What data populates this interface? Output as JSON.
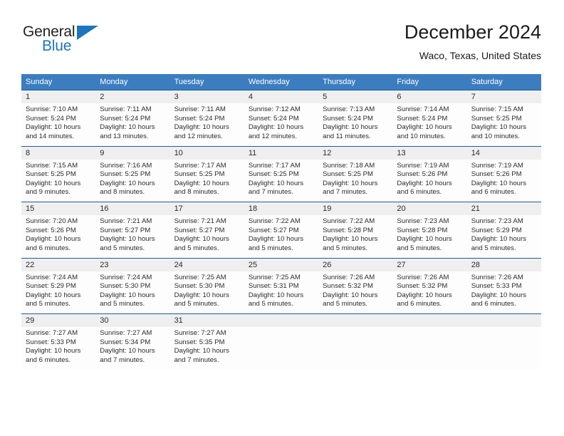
{
  "logo": {
    "word_dark": "General",
    "word_blue": "Blue",
    "triangle_color": "#1b76bc",
    "dark_color": "#231f20"
  },
  "header": {
    "title": "December 2024",
    "subtitle": "Waco, Texas, United States"
  },
  "colors": {
    "header_bg": "#3b7dbf",
    "week_separator": "#1f5c9e",
    "daynum_bg": "#efefef",
    "cell_bg": "#fdfdfd",
    "text": "#2b2b2b"
  },
  "weekday_headers": [
    "Sunday",
    "Monday",
    "Tuesday",
    "Wednesday",
    "Thursday",
    "Friday",
    "Saturday"
  ],
  "weeks": [
    {
      "days": [
        {
          "date": "1",
          "sunrise": "Sunrise: 7:10 AM",
          "sunset": "Sunset: 5:24 PM",
          "daylight1": "Daylight: 10 hours",
          "daylight2": "and 14 minutes."
        },
        {
          "date": "2",
          "sunrise": "Sunrise: 7:11 AM",
          "sunset": "Sunset: 5:24 PM",
          "daylight1": "Daylight: 10 hours",
          "daylight2": "and 13 minutes."
        },
        {
          "date": "3",
          "sunrise": "Sunrise: 7:11 AM",
          "sunset": "Sunset: 5:24 PM",
          "daylight1": "Daylight: 10 hours",
          "daylight2": "and 12 minutes."
        },
        {
          "date": "4",
          "sunrise": "Sunrise: 7:12 AM",
          "sunset": "Sunset: 5:24 PM",
          "daylight1": "Daylight: 10 hours",
          "daylight2": "and 12 minutes."
        },
        {
          "date": "5",
          "sunrise": "Sunrise: 7:13 AM",
          "sunset": "Sunset: 5:24 PM",
          "daylight1": "Daylight: 10 hours",
          "daylight2": "and 11 minutes."
        },
        {
          "date": "6",
          "sunrise": "Sunrise: 7:14 AM",
          "sunset": "Sunset: 5:24 PM",
          "daylight1": "Daylight: 10 hours",
          "daylight2": "and 10 minutes."
        },
        {
          "date": "7",
          "sunrise": "Sunrise: 7:15 AM",
          "sunset": "Sunset: 5:25 PM",
          "daylight1": "Daylight: 10 hours",
          "daylight2": "and 10 minutes."
        }
      ]
    },
    {
      "days": [
        {
          "date": "8",
          "sunrise": "Sunrise: 7:15 AM",
          "sunset": "Sunset: 5:25 PM",
          "daylight1": "Daylight: 10 hours",
          "daylight2": "and 9 minutes."
        },
        {
          "date": "9",
          "sunrise": "Sunrise: 7:16 AM",
          "sunset": "Sunset: 5:25 PM",
          "daylight1": "Daylight: 10 hours",
          "daylight2": "and 8 minutes."
        },
        {
          "date": "10",
          "sunrise": "Sunrise: 7:17 AM",
          "sunset": "Sunset: 5:25 PM",
          "daylight1": "Daylight: 10 hours",
          "daylight2": "and 8 minutes."
        },
        {
          "date": "11",
          "sunrise": "Sunrise: 7:17 AM",
          "sunset": "Sunset: 5:25 PM",
          "daylight1": "Daylight: 10 hours",
          "daylight2": "and 7 minutes."
        },
        {
          "date": "12",
          "sunrise": "Sunrise: 7:18 AM",
          "sunset": "Sunset: 5:25 PM",
          "daylight1": "Daylight: 10 hours",
          "daylight2": "and 7 minutes."
        },
        {
          "date": "13",
          "sunrise": "Sunrise: 7:19 AM",
          "sunset": "Sunset: 5:26 PM",
          "daylight1": "Daylight: 10 hours",
          "daylight2": "and 6 minutes."
        },
        {
          "date": "14",
          "sunrise": "Sunrise: 7:19 AM",
          "sunset": "Sunset: 5:26 PM",
          "daylight1": "Daylight: 10 hours",
          "daylight2": "and 6 minutes."
        }
      ]
    },
    {
      "days": [
        {
          "date": "15",
          "sunrise": "Sunrise: 7:20 AM",
          "sunset": "Sunset: 5:26 PM",
          "daylight1": "Daylight: 10 hours",
          "daylight2": "and 6 minutes."
        },
        {
          "date": "16",
          "sunrise": "Sunrise: 7:21 AM",
          "sunset": "Sunset: 5:27 PM",
          "daylight1": "Daylight: 10 hours",
          "daylight2": "and 5 minutes."
        },
        {
          "date": "17",
          "sunrise": "Sunrise: 7:21 AM",
          "sunset": "Sunset: 5:27 PM",
          "daylight1": "Daylight: 10 hours",
          "daylight2": "and 5 minutes."
        },
        {
          "date": "18",
          "sunrise": "Sunrise: 7:22 AM",
          "sunset": "Sunset: 5:27 PM",
          "daylight1": "Daylight: 10 hours",
          "daylight2": "and 5 minutes."
        },
        {
          "date": "19",
          "sunrise": "Sunrise: 7:22 AM",
          "sunset": "Sunset: 5:28 PM",
          "daylight1": "Daylight: 10 hours",
          "daylight2": "and 5 minutes."
        },
        {
          "date": "20",
          "sunrise": "Sunrise: 7:23 AM",
          "sunset": "Sunset: 5:28 PM",
          "daylight1": "Daylight: 10 hours",
          "daylight2": "and 5 minutes."
        },
        {
          "date": "21",
          "sunrise": "Sunrise: 7:23 AM",
          "sunset": "Sunset: 5:29 PM",
          "daylight1": "Daylight: 10 hours",
          "daylight2": "and 5 minutes."
        }
      ]
    },
    {
      "days": [
        {
          "date": "22",
          "sunrise": "Sunrise: 7:24 AM",
          "sunset": "Sunset: 5:29 PM",
          "daylight1": "Daylight: 10 hours",
          "daylight2": "and 5 minutes."
        },
        {
          "date": "23",
          "sunrise": "Sunrise: 7:24 AM",
          "sunset": "Sunset: 5:30 PM",
          "daylight1": "Daylight: 10 hours",
          "daylight2": "and 5 minutes."
        },
        {
          "date": "24",
          "sunrise": "Sunrise: 7:25 AM",
          "sunset": "Sunset: 5:30 PM",
          "daylight1": "Daylight: 10 hours",
          "daylight2": "and 5 minutes."
        },
        {
          "date": "25",
          "sunrise": "Sunrise: 7:25 AM",
          "sunset": "Sunset: 5:31 PM",
          "daylight1": "Daylight: 10 hours",
          "daylight2": "and 5 minutes."
        },
        {
          "date": "26",
          "sunrise": "Sunrise: 7:26 AM",
          "sunset": "Sunset: 5:32 PM",
          "daylight1": "Daylight: 10 hours",
          "daylight2": "and 5 minutes."
        },
        {
          "date": "27",
          "sunrise": "Sunrise: 7:26 AM",
          "sunset": "Sunset: 5:32 PM",
          "daylight1": "Daylight: 10 hours",
          "daylight2": "and 6 minutes."
        },
        {
          "date": "28",
          "sunrise": "Sunrise: 7:26 AM",
          "sunset": "Sunset: 5:33 PM",
          "daylight1": "Daylight: 10 hours",
          "daylight2": "and 6 minutes."
        }
      ]
    },
    {
      "days": [
        {
          "date": "29",
          "sunrise": "Sunrise: 7:27 AM",
          "sunset": "Sunset: 5:33 PM",
          "daylight1": "Daylight: 10 hours",
          "daylight2": "and 6 minutes."
        },
        {
          "date": "30",
          "sunrise": "Sunrise: 7:27 AM",
          "sunset": "Sunset: 5:34 PM",
          "daylight1": "Daylight: 10 hours",
          "daylight2": "and 7 minutes."
        },
        {
          "date": "31",
          "sunrise": "Sunrise: 7:27 AM",
          "sunset": "Sunset: 5:35 PM",
          "daylight1": "Daylight: 10 hours",
          "daylight2": "and 7 minutes."
        },
        {
          "date": "",
          "sunrise": "",
          "sunset": "",
          "daylight1": "",
          "daylight2": ""
        },
        {
          "date": "",
          "sunrise": "",
          "sunset": "",
          "daylight1": "",
          "daylight2": ""
        },
        {
          "date": "",
          "sunrise": "",
          "sunset": "",
          "daylight1": "",
          "daylight2": ""
        },
        {
          "date": "",
          "sunrise": "",
          "sunset": "",
          "daylight1": "",
          "daylight2": ""
        }
      ]
    }
  ]
}
